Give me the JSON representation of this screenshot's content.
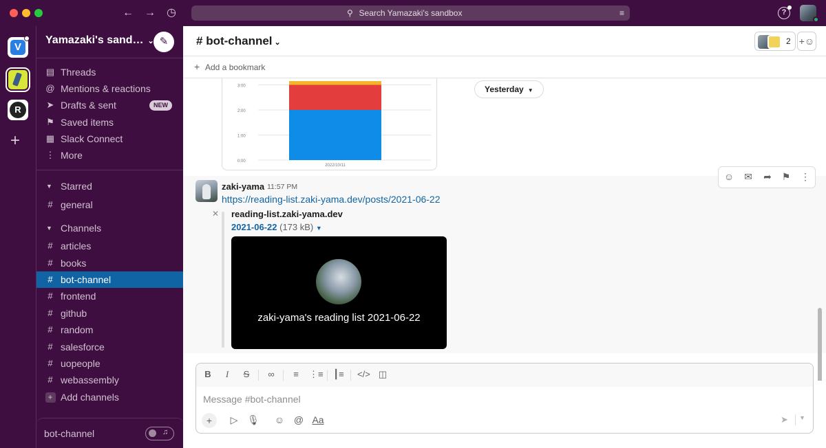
{
  "titlebar": {
    "search_placeholder": "Search Yamazaki's sandbox",
    "icons": [
      "back-arrow-icon",
      "forward-arrow-icon",
      "history-icon",
      "search-icon",
      "filter-icon",
      "help-icon"
    ]
  },
  "workspace": {
    "name": "Yamazaki's sand…",
    "rail_letters": [
      "V",
      "R"
    ]
  },
  "sidebar": {
    "nav": [
      {
        "label": "Threads",
        "icon": "threads-icon"
      },
      {
        "label": "Mentions & reactions",
        "icon": "at-icon"
      },
      {
        "label": "Drafts & sent",
        "icon": "send-icon",
        "badge": "NEW"
      },
      {
        "label": "Saved items",
        "icon": "bookmark-icon"
      },
      {
        "label": "Slack Connect",
        "icon": "building-icon"
      },
      {
        "label": "More",
        "icon": "more-icon"
      }
    ],
    "starred": {
      "label": "Starred",
      "channels": [
        "general"
      ]
    },
    "channels": {
      "label": "Channels",
      "items": [
        "articles",
        "books",
        "bot-channel",
        "frontend",
        "github",
        "random",
        "salesforce",
        "uopeople",
        "webassembly"
      ],
      "active": "bot-channel",
      "add_label": "Add channels"
    },
    "huddle": {
      "label": "bot-channel"
    }
  },
  "channel": {
    "name": "bot-channel",
    "member_count": "2",
    "add_bookmark": "Add a bookmark"
  },
  "chart_data": {
    "type": "bar",
    "categories": [
      "2022/10/11"
    ],
    "ytick_labels": [
      "0:00",
      "1:00",
      "2:00",
      "3:00"
    ],
    "ylim": [
      0,
      3.5
    ],
    "series": [
      {
        "color": "#0e8ce8",
        "values": [
          2.0
        ]
      },
      {
        "color": "#e43d3d",
        "values": [
          1.0
        ]
      },
      {
        "color": "#f4b629",
        "values": [
          0.15
        ]
      }
    ]
  },
  "day_divider": "Yesterday",
  "message": {
    "author": "zaki-yama",
    "time": "11:57 PM",
    "link": "https://reading-list.zaki-yama.dev/posts/2021-06-22",
    "unfurl": {
      "site": "reading-list.zaki-yama.dev",
      "file_name": "2021-06-22",
      "file_size": "(173 kB)",
      "preview_caption": "zaki-yama's reading list 2021-06-22"
    }
  },
  "composer": {
    "placeholder": "Message #bot-channel",
    "format_icons": [
      "bold-icon",
      "italic-icon",
      "strikethrough-icon",
      "link-icon",
      "ordered-list-icon",
      "bullet-list-icon",
      "blockquote-icon",
      "code-icon",
      "code-block-icon"
    ],
    "tool_icons": [
      "plus-icon",
      "video-icon",
      "microphone-icon",
      "emoji-icon",
      "mention-icon",
      "text-format-icon"
    ]
  },
  "colors": {
    "sidebar_bg": "#3f0e40",
    "active_channel": "#1164a3",
    "link": "#1264a3"
  }
}
